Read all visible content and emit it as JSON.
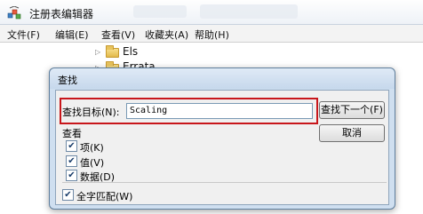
{
  "window": {
    "title": "注册表编辑器"
  },
  "menu": {
    "items": [
      "文件(F)",
      "编辑(E)",
      "查看(V)",
      "收藏夹(A)",
      "帮助(H)"
    ]
  },
  "tree": {
    "items": [
      {
        "label": "Els"
      },
      {
        "label": "Errata"
      }
    ]
  },
  "find_dialog": {
    "title": "查找",
    "target_label": "查找目标(N):",
    "search_value": "Scaling",
    "find_next_label": "查找下一个(F)",
    "cancel_label": "取消",
    "look_at_label": "查看",
    "options": [
      {
        "label": "项(K)",
        "checked": true
      },
      {
        "label": "值(V)",
        "checked": true
      },
      {
        "label": "数据(D)",
        "checked": true
      }
    ],
    "whole_string": {
      "label": "全字匹配(W)",
      "checked": true
    }
  },
  "colors": {
    "highlight_box": "#c8161b",
    "dialog_frame": "#cfdff0"
  }
}
